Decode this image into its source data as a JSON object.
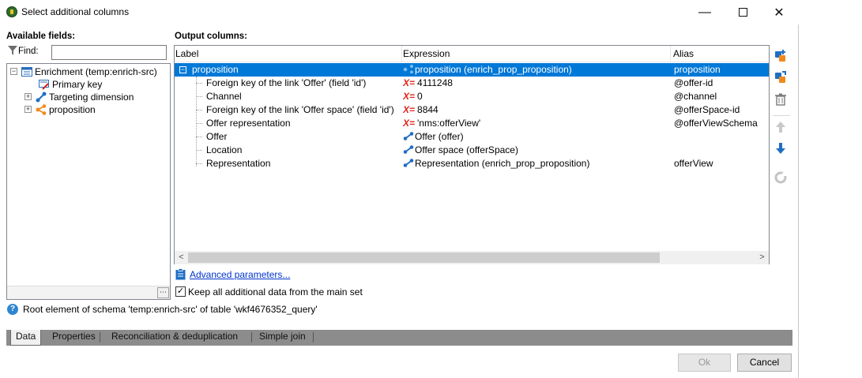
{
  "window": {
    "title": "Select additional columns",
    "minimize": "—",
    "close": "✕"
  },
  "available_fields": {
    "label": "Available fields:",
    "find_label": "Find:",
    "find_value": "",
    "tree": [
      {
        "label": "Enrichment (temp:enrich-src)",
        "expander": "⊟",
        "icon": "schema-icon"
      },
      {
        "label": "Primary key",
        "icon": "primary-key-icon"
      },
      {
        "label": "Targeting dimension",
        "expander": "⊞",
        "icon": "link-icon"
      },
      {
        "label": "proposition",
        "expander": "⊞",
        "icon": "collection-icon"
      }
    ],
    "footer_button": "⋯"
  },
  "output_columns": {
    "label": "Output columns:",
    "headers": {
      "label": "Label",
      "expression": "Expression",
      "alias": "Alias"
    },
    "rows": [
      {
        "label": "proposition",
        "expression": "proposition (enrich_prop_proposition)",
        "alias": "proposition",
        "expr_icon": "collection-icon",
        "selected": true
      },
      {
        "label": "Foreign key of the link 'Offer' (field 'id')",
        "expr_mark": "X=",
        "expression": "4111248",
        "alias": "@offer-id"
      },
      {
        "label": "Channel",
        "expr_mark": "X=",
        "expression": "0",
        "alias": "@channel"
      },
      {
        "label": "Foreign key of the link 'Offer space' (field 'id')",
        "expr_mark": "X=",
        "expression": "8844",
        "alias": "@offerSpace-id"
      },
      {
        "label": "Offer representation",
        "expr_mark": "X=",
        "expression": "'nms:offerView'",
        "alias": "@offerViewSchema"
      },
      {
        "label": "Offer",
        "expr_icon": "link-icon",
        "expression": "Offer (offer)",
        "alias": ""
      },
      {
        "label": "Location",
        "expr_icon": "link-icon",
        "expression": "Offer space (offerSpace)",
        "alias": ""
      },
      {
        "label": "Representation",
        "expr_icon": "link-icon",
        "expression": "Representation (enrich_prop_proposition)",
        "alias": "offerView"
      }
    ],
    "scroll_left": "<",
    "scroll_right": ">"
  },
  "advanced_link": "Advanced parameters...",
  "keep_checkbox": {
    "label": "Keep all additional data from the main set",
    "checked": true,
    "mark": "✓"
  },
  "status": {
    "icon": "?",
    "text": "Root element of schema 'temp:enrich-src' of table 'wkf4676352_query'"
  },
  "tabs": [
    "Data",
    "Properties",
    "Reconciliation & deduplication",
    "Simple join"
  ],
  "buttons": {
    "ok": "Ok",
    "cancel": "Cancel"
  },
  "colors": {
    "selection": "#0078d7",
    "link": "#0033cc",
    "expr_mark": "#e2231a",
    "tabbar": "#8c8c8c"
  }
}
